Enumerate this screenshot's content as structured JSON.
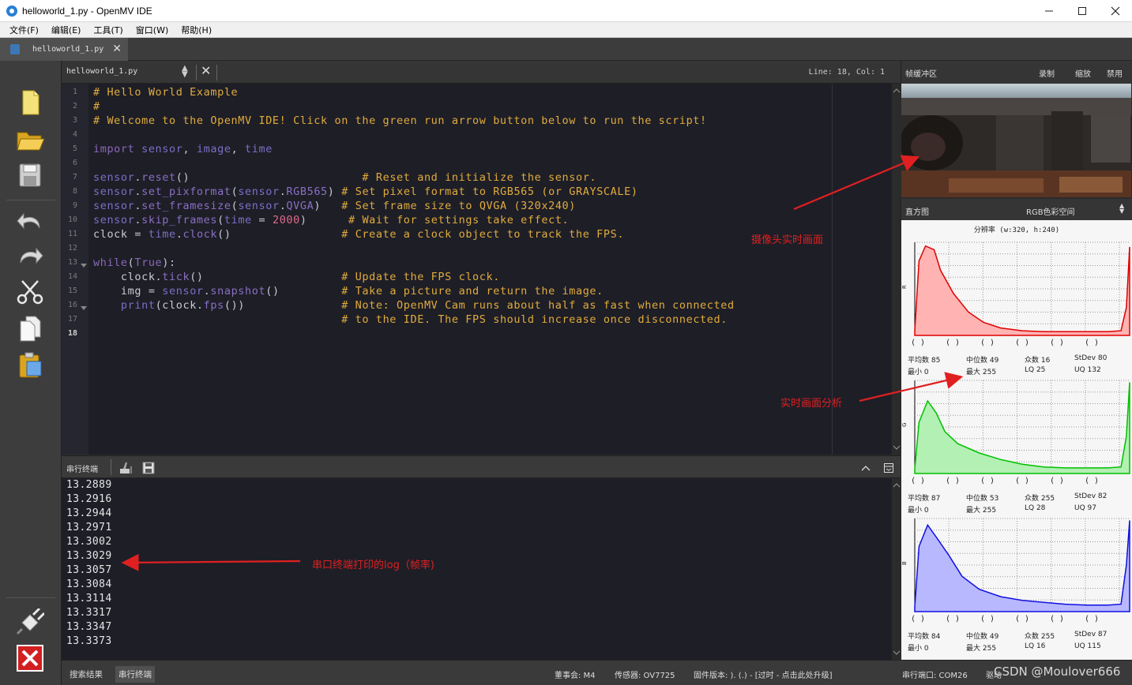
{
  "window": {
    "title": "helloworld_1.py - OpenMV IDE",
    "min_icon": "minimize-icon",
    "max_icon": "maximize-icon",
    "close_icon": "close-icon"
  },
  "menu": [
    "文件(F)",
    "编辑(E)",
    "工具(T)",
    "窗口(W)",
    "帮助(H)"
  ],
  "tab": {
    "label": "helloworld_1.py"
  },
  "editor_header": {
    "file": "helloworld_1.py",
    "cursor": "Line: 18, Col: 1"
  },
  "toolbar_icons": [
    "new-file-icon",
    "open-folder-icon",
    "save-icon",
    "undo-icon",
    "redo-icon",
    "cut-icon",
    "copy-icon",
    "paste-icon",
    "connect-icon",
    "stop-icon"
  ],
  "code": {
    "line_numbers": [
      "1",
      "2",
      "3",
      "4",
      "5",
      "6",
      "7",
      "8",
      "9",
      "10",
      "11",
      "12",
      "13",
      "14",
      "15",
      "16",
      "17",
      "18"
    ],
    "active_line": "18",
    "lines": [
      [
        {
          "t": "# Hello World Example",
          "c": "cmt"
        }
      ],
      [
        {
          "t": "#",
          "c": "cmt"
        }
      ],
      [
        {
          "t": "# Welcome to the OpenMV IDE! Click on the green run arrow button below to run the script!",
          "c": "cmt"
        }
      ],
      [],
      [
        {
          "t": "import ",
          "c": "kw"
        },
        {
          "t": "sensor",
          "c": "mod"
        },
        {
          "t": ", ",
          "c": "def"
        },
        {
          "t": "image",
          "c": "mod"
        },
        {
          "t": ", ",
          "c": "def"
        },
        {
          "t": "time",
          "c": "mod"
        }
      ],
      [],
      [
        {
          "t": "sensor",
          "c": "mod"
        },
        {
          "t": ".",
          "c": "def"
        },
        {
          "t": "reset",
          "c": "attr"
        },
        {
          "t": "()                         ",
          "c": "def"
        },
        {
          "t": "# Reset and initialize the sensor.",
          "c": "cmt"
        }
      ],
      [
        {
          "t": "sensor",
          "c": "mod"
        },
        {
          "t": ".",
          "c": "def"
        },
        {
          "t": "set_pixformat",
          "c": "attr"
        },
        {
          "t": "(",
          "c": "def"
        },
        {
          "t": "sensor",
          "c": "mod"
        },
        {
          "t": ".",
          "c": "def"
        },
        {
          "t": "RGB565",
          "c": "attr"
        },
        {
          "t": ") ",
          "c": "def"
        },
        {
          "t": "# Set pixel format to RGB565 (or GRAYSCALE)",
          "c": "cmt"
        }
      ],
      [
        {
          "t": "sensor",
          "c": "mod"
        },
        {
          "t": ".",
          "c": "def"
        },
        {
          "t": "set_framesize",
          "c": "attr"
        },
        {
          "t": "(",
          "c": "def"
        },
        {
          "t": "sensor",
          "c": "mod"
        },
        {
          "t": ".",
          "c": "def"
        },
        {
          "t": "QVGA",
          "c": "attr"
        },
        {
          "t": ")   ",
          "c": "def"
        },
        {
          "t": "# Set frame size to QVGA (320x240)",
          "c": "cmt"
        }
      ],
      [
        {
          "t": "sensor",
          "c": "mod"
        },
        {
          "t": ".",
          "c": "def"
        },
        {
          "t": "skip_frames",
          "c": "attr"
        },
        {
          "t": "(",
          "c": "def"
        },
        {
          "t": "time",
          "c": "mod"
        },
        {
          "t": " = ",
          "c": "def"
        },
        {
          "t": "2000",
          "c": "num"
        },
        {
          "t": ")      ",
          "c": "def"
        },
        {
          "t": "# Wait for settings take effect.",
          "c": "cmt"
        }
      ],
      [
        {
          "t": "clock = ",
          "c": "def"
        },
        {
          "t": "time",
          "c": "mod"
        },
        {
          "t": ".",
          "c": "def"
        },
        {
          "t": "clock",
          "c": "attr"
        },
        {
          "t": "()                ",
          "c": "def"
        },
        {
          "t": "# Create a clock object to track the FPS.",
          "c": "cmt"
        }
      ],
      [],
      [
        {
          "t": "while",
          "c": "kw"
        },
        {
          "t": "(",
          "c": "def"
        },
        {
          "t": "True",
          "c": "kw"
        },
        {
          "t": "):",
          "c": "def"
        }
      ],
      [
        {
          "t": "    clock.",
          "c": "def"
        },
        {
          "t": "tick",
          "c": "attr"
        },
        {
          "t": "()                    ",
          "c": "def"
        },
        {
          "t": "# Update the FPS clock.",
          "c": "cmt"
        }
      ],
      [
        {
          "t": "    img = ",
          "c": "def"
        },
        {
          "t": "sensor",
          "c": "mod"
        },
        {
          "t": ".",
          "c": "def"
        },
        {
          "t": "snapshot",
          "c": "attr"
        },
        {
          "t": "()         ",
          "c": "def"
        },
        {
          "t": "# Take a picture and return the image.",
          "c": "cmt"
        }
      ],
      [
        {
          "t": "    ",
          "c": "def"
        },
        {
          "t": "print",
          "c": "mod"
        },
        {
          "t": "(clock.",
          "c": "def"
        },
        {
          "t": "fps",
          "c": "attr"
        },
        {
          "t": "())              ",
          "c": "def"
        },
        {
          "t": "# Note: OpenMV Cam runs about half as fast when connected",
          "c": "cmt"
        }
      ],
      [
        {
          "t": "                                    ",
          "c": "def"
        },
        {
          "t": "# to the IDE. The FPS should increase once disconnected.",
          "c": "cmt"
        }
      ],
      []
    ]
  },
  "terminal": {
    "label": "串行终端",
    "lines": [
      "13.2889",
      "13.2916",
      "13.2944",
      "13.2971",
      "13.3002",
      "13.3029",
      "13.3057",
      "13.3084",
      "13.3114",
      "13.3317",
      "13.3347",
      "13.3373"
    ]
  },
  "framebuffer": {
    "label": "帧缓冲区",
    "record": "录制",
    "zoom": "缩放",
    "disable": "禁用"
  },
  "histogram": {
    "label": "直方图",
    "colorspace": "RGB色彩空间",
    "resolution": "分辨率 (w:320, h:240)",
    "channels": [
      {
        "name": "R",
        "color": "#ffb3b3",
        "stroke": "#e00000",
        "stats": {
          "mean": "85",
          "median": "49",
          "mode": "16",
          "stdev": "80",
          "min": "0",
          "max": "255",
          "lq": "25",
          "uq": "132"
        }
      },
      {
        "name": "G",
        "color": "#b3f0b3",
        "stroke": "#00c000",
        "stats": {
          "mean": "87",
          "median": "53",
          "mode": "255",
          "stdev": "82",
          "min": "0",
          "max": "255",
          "lq": "28",
          "uq": "97"
        }
      },
      {
        "name": "B",
        "color": "#b8b8ff",
        "stroke": "#1010e0",
        "stats": {
          "mean": "84",
          "median": "49",
          "mode": "255",
          "stdev": "87",
          "min": "0",
          "max": "255",
          "lq": "16",
          "uq": "115"
        }
      }
    ],
    "stat_labels": {
      "mean": "平均数",
      "median": "中位数",
      "mode": "众数",
      "stdev": "StDev",
      "min": "最小",
      "max": "最大",
      "lq": "LQ",
      "uq": "UQ"
    },
    "ctrl_marks": [
      "( )",
      "( )",
      "( )",
      "( )",
      "( )",
      "( )"
    ]
  },
  "statusbar": {
    "tab_search": "搜索结果",
    "tab_terminal": "串行终端",
    "board": "董事会: M4",
    "sensor": "传感器: OV7725",
    "firmware": "固件版本: ). (.) - [过时 - 点击此处升级]",
    "port": "串行端口: COM26",
    "extra": "驱动"
  },
  "annotations": {
    "camera": "摄像头实时画面",
    "analysis": "实时画面分析",
    "log": "串口终端打印的log（帧率)"
  },
  "watermark": "CSDN @Moulover666",
  "colors": {
    "accent_red": "#e02020",
    "editor_bg": "#1e1e27",
    "comment": "#e0ac3c"
  }
}
